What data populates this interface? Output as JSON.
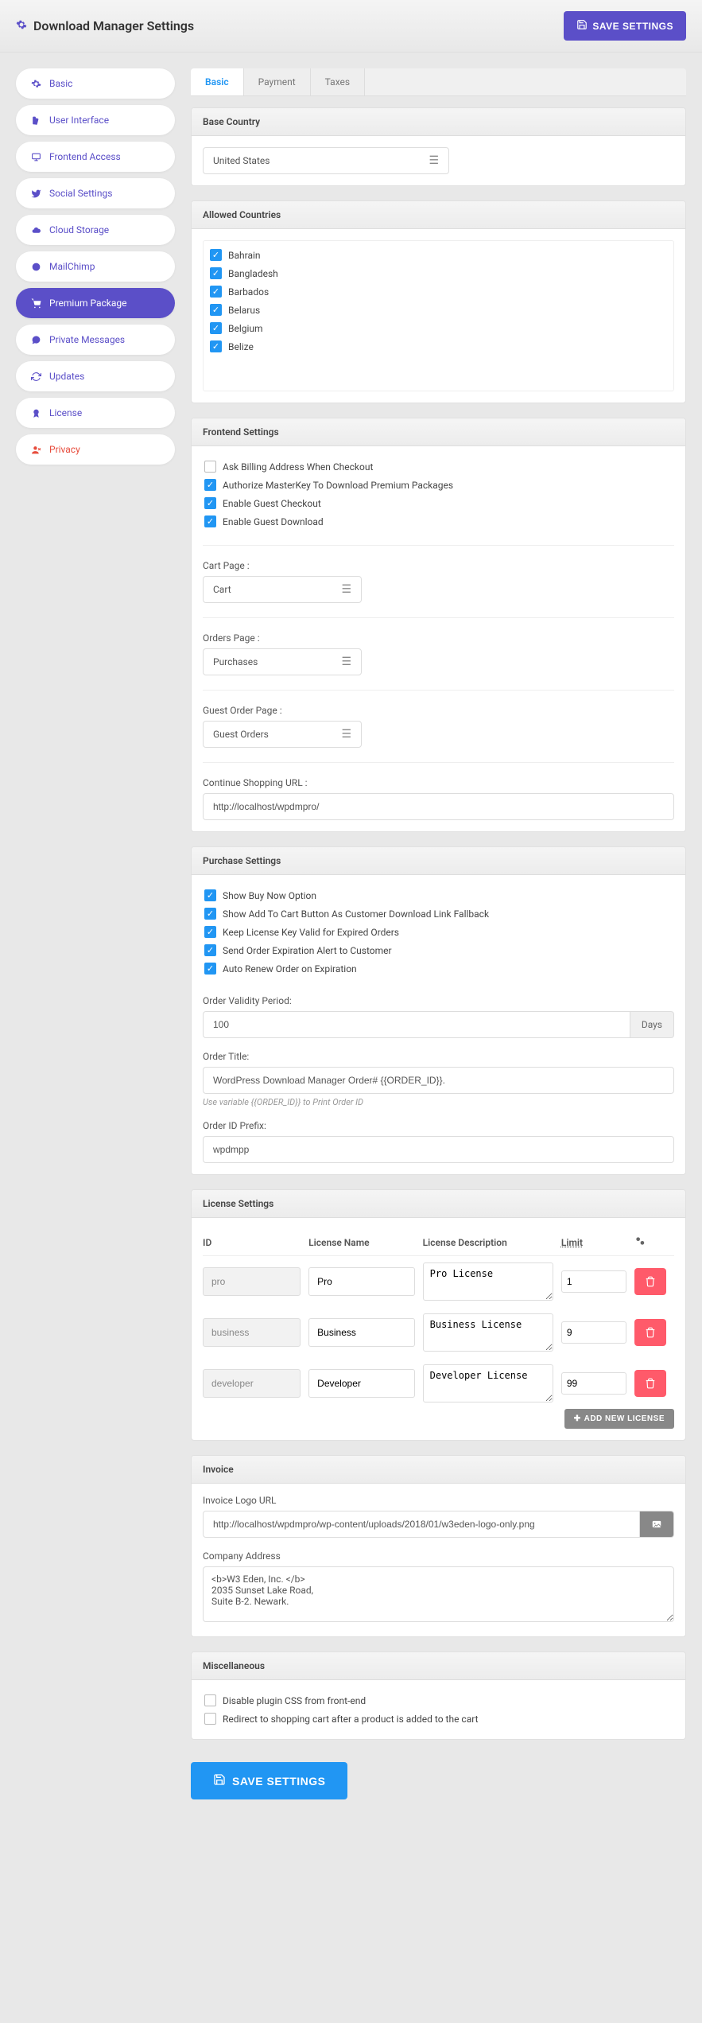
{
  "header": {
    "title": "Download Manager Settings",
    "save_btn": "SAVE SETTINGS"
  },
  "sidebar": {
    "items": [
      {
        "icon": "gear",
        "label": "Basic"
      },
      {
        "icon": "swatch",
        "label": "User Interface"
      },
      {
        "icon": "monitor",
        "label": "Frontend Access"
      },
      {
        "icon": "twitter",
        "label": "Social Settings"
      },
      {
        "icon": "cloud",
        "label": "Cloud Storage"
      },
      {
        "icon": "mailchimp",
        "label": "MailChimp"
      },
      {
        "icon": "cart",
        "label": "Premium Package",
        "active": true
      },
      {
        "icon": "chat",
        "label": "Private Messages"
      },
      {
        "icon": "sync",
        "label": "Updates"
      },
      {
        "icon": "certificate",
        "label": "License"
      },
      {
        "icon": "userx",
        "label": "Privacy",
        "red": true
      }
    ]
  },
  "tabs": [
    {
      "label": "Basic",
      "active": true
    },
    {
      "label": "Payment"
    },
    {
      "label": "Taxes"
    }
  ],
  "panels": {
    "base_country": {
      "title": "Base Country",
      "value": "United States"
    },
    "allowed_countries": {
      "title": "Allowed Countries",
      "items": [
        {
          "label": "Bahrain",
          "checked": true
        },
        {
          "label": "Bangladesh",
          "checked": true
        },
        {
          "label": "Barbados",
          "checked": true
        },
        {
          "label": "Belarus",
          "checked": true
        },
        {
          "label": "Belgium",
          "checked": true
        },
        {
          "label": "Belize",
          "checked": true
        }
      ]
    },
    "frontend": {
      "title": "Frontend Settings",
      "checks": [
        {
          "label": "Ask Billing Address When Checkout",
          "checked": false
        },
        {
          "label": "Authorize MasterKey To Download Premium Packages",
          "checked": true
        },
        {
          "label": "Enable Guest Checkout",
          "checked": true
        },
        {
          "label": "Enable Guest Download",
          "checked": true
        }
      ],
      "cart_label": "Cart Page :",
      "cart_value": "Cart",
      "orders_label": "Orders Page :",
      "orders_value": "Purchases",
      "guest_label": "Guest Order Page :",
      "guest_value": "Guest Orders",
      "continue_label": "Continue Shopping URL :",
      "continue_value": "http://localhost/wpdmpro/"
    },
    "purchase": {
      "title": "Purchase Settings",
      "checks": [
        {
          "label": "Show Buy Now Option",
          "checked": true
        },
        {
          "label": "Show Add To Cart Button As Customer Download Link Fallback",
          "checked": true
        },
        {
          "label": "Keep License Key Valid for Expired Orders",
          "checked": true
        },
        {
          "label": "Send Order Expiration Alert to Customer",
          "checked": true
        },
        {
          "label": "Auto Renew Order on Expiration",
          "checked": true
        }
      ],
      "validity_label": "Order Validity Period:",
      "validity_value": "100",
      "validity_unit": "Days",
      "ordertitle_label": "Order Title:",
      "ordertitle_value": "WordPress Download Manager Order# {{ORDER_ID}}.",
      "ordertitle_help": "Use variable {{ORDER_ID}} to Print Order ID",
      "prefix_label": "Order ID Prefix:",
      "prefix_value": "wpdmpp"
    },
    "license": {
      "title": "License Settings",
      "cols": {
        "id": "ID",
        "name": "License Name",
        "desc": "License Description",
        "limit": "Limit"
      },
      "rows": [
        {
          "id": "pro",
          "name": "Pro",
          "desc": "Pro License",
          "limit": "1"
        },
        {
          "id": "business",
          "name": "Business",
          "desc": "Business License",
          "limit": "9"
        },
        {
          "id": "developer",
          "name": "Developer",
          "desc": "Developer License",
          "limit": "99"
        }
      ],
      "add_btn": "ADD NEW LICENSE"
    },
    "invoice": {
      "title": "Invoice",
      "logo_label": "Invoice Logo URL",
      "logo_value": "http://localhost/wpdmpro/wp-content/uploads/2018/01/w3eden-logo-only.png",
      "company_label": "Company Address",
      "company_value": "<b>W3 Eden, Inc. </b>\n2035 Sunset Lake Road,\nSuite B-2. Newark."
    },
    "misc": {
      "title": "Miscellaneous",
      "checks": [
        {
          "label": "Disable plugin CSS from front-end",
          "checked": false
        },
        {
          "label": "Redirect to shopping cart after a product is added to the cart",
          "checked": false
        }
      ]
    }
  },
  "footer": {
    "save_btn": "SAVE SETTINGS"
  }
}
